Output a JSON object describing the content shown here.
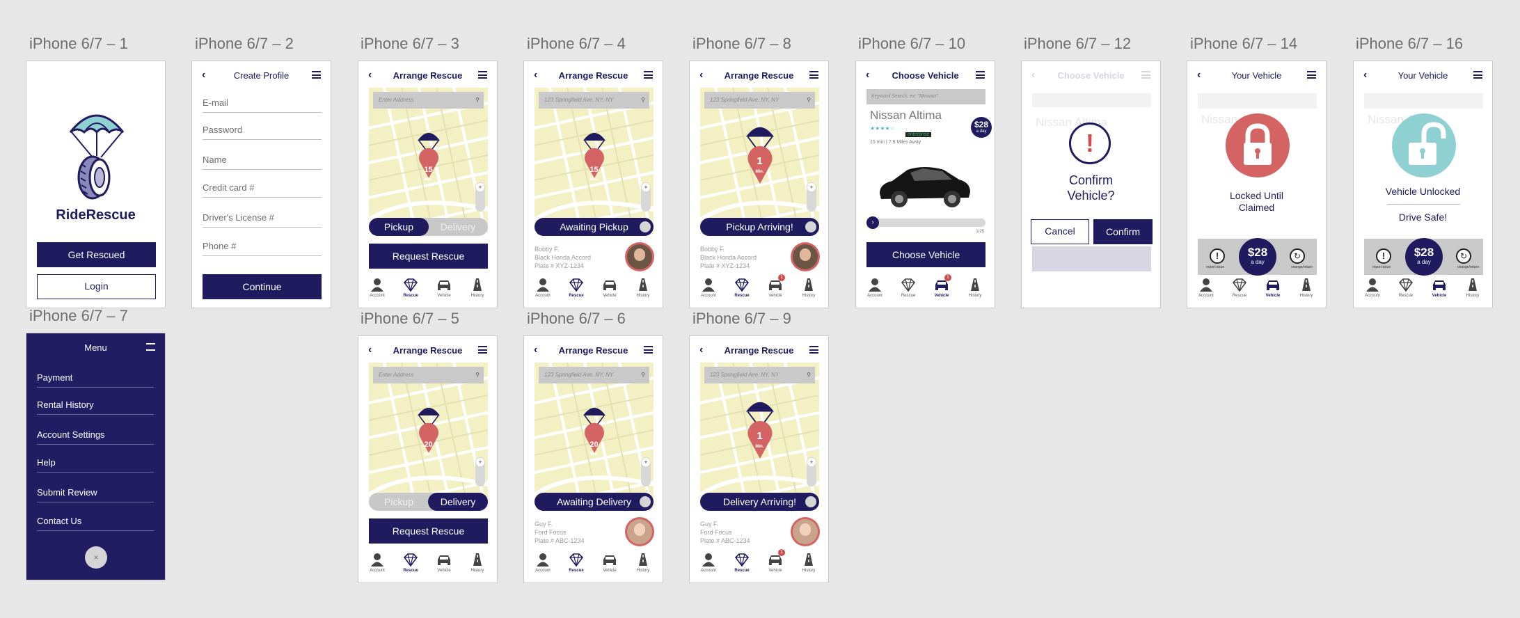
{
  "artboards": {
    "a1": "iPhone 6/7 – 1",
    "a2": "iPhone 6/7 – 2",
    "a3": "iPhone 6/7 – 3",
    "a4": "iPhone 6/7 – 4",
    "a8": "iPhone 6/7 – 8",
    "a10": "iPhone 6/7 – 10",
    "a12": "iPhone 6/7 – 12",
    "a14": "iPhone 6/7 – 14",
    "a16": "iPhone 6/7 – 16",
    "a7": "iPhone 6/7 – 7",
    "a5": "iPhone 6/7 – 5",
    "a6": "iPhone 6/7 – 6",
    "a9": "iPhone 6/7 – 9"
  },
  "colors": {
    "navy": "#1f1b5e",
    "red": "#d46363",
    "teal": "#8fd0d3",
    "map": "#f3f1c4"
  },
  "splash": {
    "brand": "RideRescue",
    "get_rescued": "Get Rescued",
    "login": "Login"
  },
  "create_profile": {
    "title": "Create Profile",
    "fields": [
      "E-mail",
      "Password",
      "Name",
      "Credit card #",
      "Driver's License #",
      "Phone #"
    ],
    "continue": "Continue"
  },
  "rescue": {
    "title": "Arrange Rescue",
    "search_placeholder": "Enter Address",
    "search_value": "123 Springfield Ave. NY, NY",
    "pickup": "Pickup",
    "delivery": "Delivery",
    "request": "Request Rescue",
    "eta_15": "15",
    "eta_20": "20",
    "eta_1": "1",
    "min": "Min.",
    "awaiting_pickup": "Awaiting Pickup",
    "pickup_arriving": "Pickup Arriving!",
    "awaiting_delivery": "Awaiting Delivery",
    "delivery_arriving": "Delivery Arriving!"
  },
  "driver_bobby": {
    "name": "Bobby F.",
    "car": "Black Honda Accord",
    "plate": "Plate # XYZ-1234"
  },
  "driver_guy": {
    "name": "Guy F.",
    "car": "Ford Focus",
    "plate": "Plate # ABC-1234"
  },
  "tabs": {
    "account": "Account",
    "rescue": "Rescue",
    "vehicle": "Vehicle",
    "history": "History",
    "badge": "1"
  },
  "choose_vehicle": {
    "title": "Choose Vehicle",
    "search_placeholder": "Keyword Search. ex: \"Minivan\"",
    "car_name": "Nissan Altima",
    "rating": "★★★★☆",
    "company": "enterprise",
    "distance": "15 min | 7.9 Miles Away",
    "price": "$28",
    "per_day": "a day",
    "page": "1/25",
    "choose": "Choose Vehicle"
  },
  "confirm_dialog": {
    "title": "Confirm Vehicle?",
    "cancel": "Cancel",
    "confirm": "Confirm"
  },
  "your_vehicle": {
    "title": "Your Vehicle",
    "locked": "Locked Until Claimed",
    "unlocked": "Vehicle Unlocked",
    "drive_safe": "Drive Safe!",
    "price": "$28",
    "per_day": "a day",
    "report": "report issue",
    "change": "change/return"
  },
  "menu": {
    "title": "Menu",
    "items": [
      "Payment",
      "Rental History",
      "Account Settings",
      "Help",
      "Submit Review",
      "Contact Us"
    ],
    "close": "×"
  }
}
